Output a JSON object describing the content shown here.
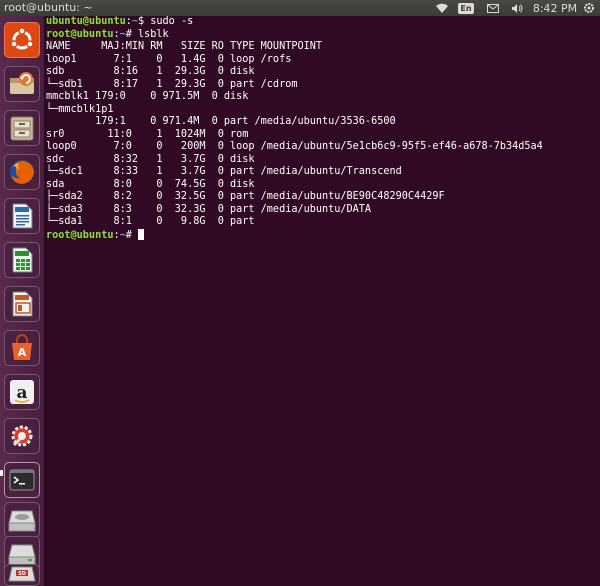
{
  "topbar": {
    "window_title": "root@ubuntu: ~",
    "language": "En",
    "time": "8:42 PM"
  },
  "launcher": {
    "items": [
      {
        "name": "ubuntu-dash",
        "icon": "ubuntu-logo-icon",
        "color": "#dd4814"
      },
      {
        "name": "software-updater",
        "icon": "update-icon",
        "color": "#e07a30"
      },
      {
        "name": "files",
        "icon": "file-cabinet-icon",
        "color": "#b8a98e"
      },
      {
        "name": "firefox",
        "icon": "firefox-icon",
        "color": "#e66000"
      },
      {
        "name": "libreoffice-writer",
        "icon": "writer-icon",
        "color": "#2a6aad"
      },
      {
        "name": "libreoffice-calc",
        "icon": "calc-icon",
        "color": "#2f8f2f"
      },
      {
        "name": "libreoffice-impress",
        "icon": "impress-icon",
        "color": "#c0582a"
      },
      {
        "name": "ubuntu-software-center",
        "icon": "shopping-bag-icon",
        "color": "#e8632c"
      },
      {
        "name": "amazon",
        "icon": "amazon-icon",
        "color": "#f0f0f0"
      },
      {
        "name": "system-settings",
        "icon": "wrench-gear-icon",
        "color": "#d04030"
      },
      {
        "name": "terminal",
        "icon": "terminal-icon",
        "color": "#2c2c2c"
      },
      {
        "name": "removable-drive",
        "icon": "drive-icon",
        "color": "#cfcfcf"
      },
      {
        "name": "usb-drive",
        "icon": "drive-icon",
        "color": "#cfcfcf"
      },
      {
        "name": "sd-card",
        "icon": "sd-card-icon",
        "color": "#c03030",
        "label": "SD"
      }
    ]
  },
  "terminal": {
    "lines": [
      [
        {
          "t": "prompt",
          "text": "ubuntu@ubuntu"
        },
        {
          "t": "plain",
          "text": ":"
        },
        {
          "t": "path",
          "text": "~"
        },
        {
          "t": "plain",
          "text": "$ sudo -s"
        }
      ],
      [
        {
          "t": "prompt",
          "text": "root@ubuntu"
        },
        {
          "t": "plain",
          "text": ":"
        },
        {
          "t": "path",
          "text": "~"
        },
        {
          "t": "plain",
          "text": "# lsblk"
        }
      ],
      [
        {
          "t": "plain",
          "text": "NAME     MAJ:MIN RM   SIZE RO TYPE MOUNTPOINT"
        }
      ],
      [
        {
          "t": "plain",
          "text": "loop1      7:1    0   1.4G  0 loop /rofs"
        }
      ],
      [
        {
          "t": "plain",
          "text": "sdb        8:16   1  29.3G  0 disk"
        }
      ],
      [
        {
          "t": "plain",
          "text": "└─sdb1     8:17   1  29.3G  0 part /cdrom"
        }
      ],
      [
        {
          "t": "plain",
          "text": "mmcblk1 179:0    0 971.5M  0 disk"
        }
      ],
      [
        {
          "t": "plain",
          "text": "└─mmcblk1p1"
        }
      ],
      [
        {
          "t": "plain",
          "text": "        179:1    0 971.4M  0 part /media/ubuntu/3536-6500"
        }
      ],
      [
        {
          "t": "plain",
          "text": "sr0       11:0    1  1024M  0 rom"
        }
      ],
      [
        {
          "t": "plain",
          "text": "loop0      7:0    0   200M  0 loop /media/ubuntu/5e1cb6c9-95f5-ef46-a678-7b34d5a4"
        }
      ],
      [
        {
          "t": "plain",
          "text": "sdc        8:32   1   3.7G  0 disk"
        }
      ],
      [
        {
          "t": "plain",
          "text": "└─sdc1     8:33   1   3.7G  0 part /media/ubuntu/Transcend"
        }
      ],
      [
        {
          "t": "plain",
          "text": "sda        8:0    0  74.5G  0 disk"
        }
      ],
      [
        {
          "t": "plain",
          "text": "├─sda2     8:2    0  32.5G  0 part /media/ubuntu/BE90C48290C4429F"
        }
      ],
      [
        {
          "t": "plain",
          "text": "├─sda3     8:3    0  32.3G  0 part /media/ubuntu/DATA"
        }
      ],
      [
        {
          "t": "plain",
          "text": "└─sda1     8:1    0   9.8G  0 part"
        }
      ],
      [
        {
          "t": "prompt",
          "text": "root@ubuntu"
        },
        {
          "t": "plain",
          "text": ":"
        },
        {
          "t": "path",
          "text": "~"
        },
        {
          "t": "plain",
          "text": "# "
        },
        {
          "t": "cursor",
          "text": ""
        }
      ]
    ]
  }
}
